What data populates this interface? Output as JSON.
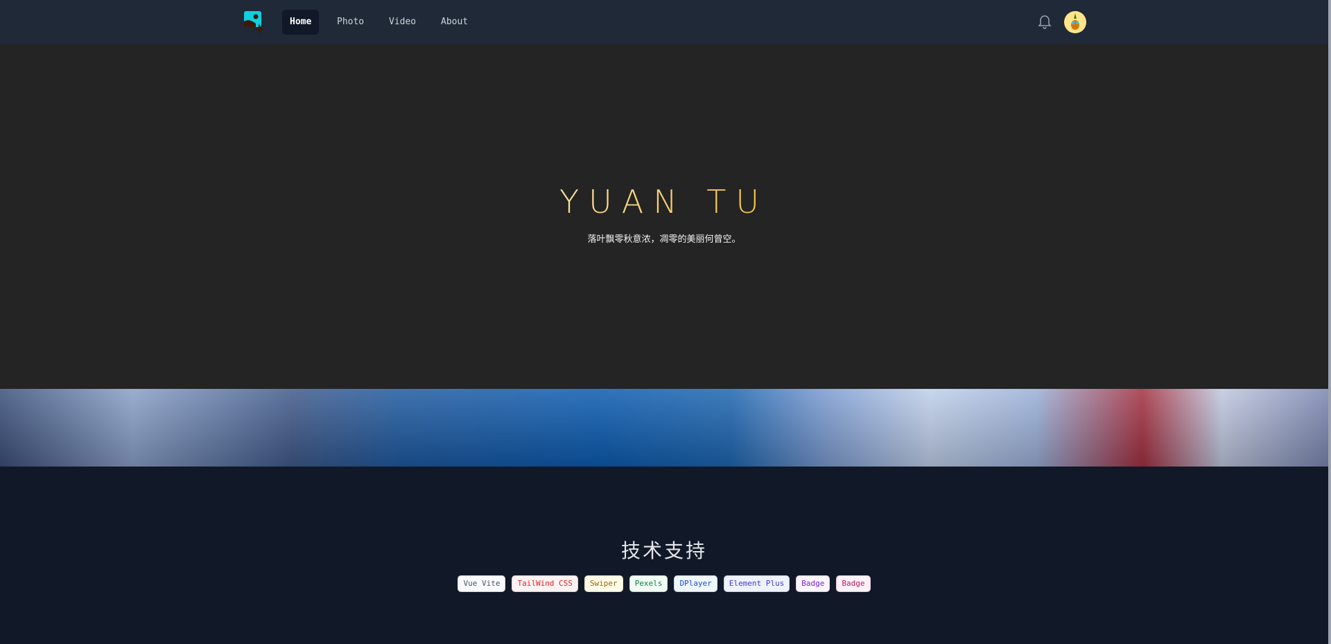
{
  "nav": {
    "items": [
      {
        "label": "Home",
        "active": true
      },
      {
        "label": "Photo"
      },
      {
        "label": "Video"
      },
      {
        "label": "About"
      }
    ]
  },
  "hero": {
    "title": "YUAN TU",
    "subtitle": "落叶飘零秋意浓，凋零的美丽何曾空。"
  },
  "tech": {
    "title": "技术支持",
    "badges": [
      {
        "label": "Vue Vite",
        "color": "#4b5563",
        "bg": "#f9fafb"
      },
      {
        "label": "TailWind CSS",
        "color": "#dc2626",
        "bg": "#fef2f2"
      },
      {
        "label": "Swiper",
        "color": "#a16207",
        "bg": "#fefce8"
      },
      {
        "label": "Pexels",
        "color": "#15803d",
        "bg": "#f0fdf4"
      },
      {
        "label": "DPlayer",
        "color": "#1d4ed8",
        "bg": "#eff6ff"
      },
      {
        "label": "Element Plus",
        "color": "#4338ca",
        "bg": "#eef2ff"
      },
      {
        "label": "Badge",
        "color": "#7e22ce",
        "bg": "#faf5ff"
      },
      {
        "label": "Badge",
        "color": "#be185d",
        "bg": "#fdf2f8"
      }
    ]
  }
}
